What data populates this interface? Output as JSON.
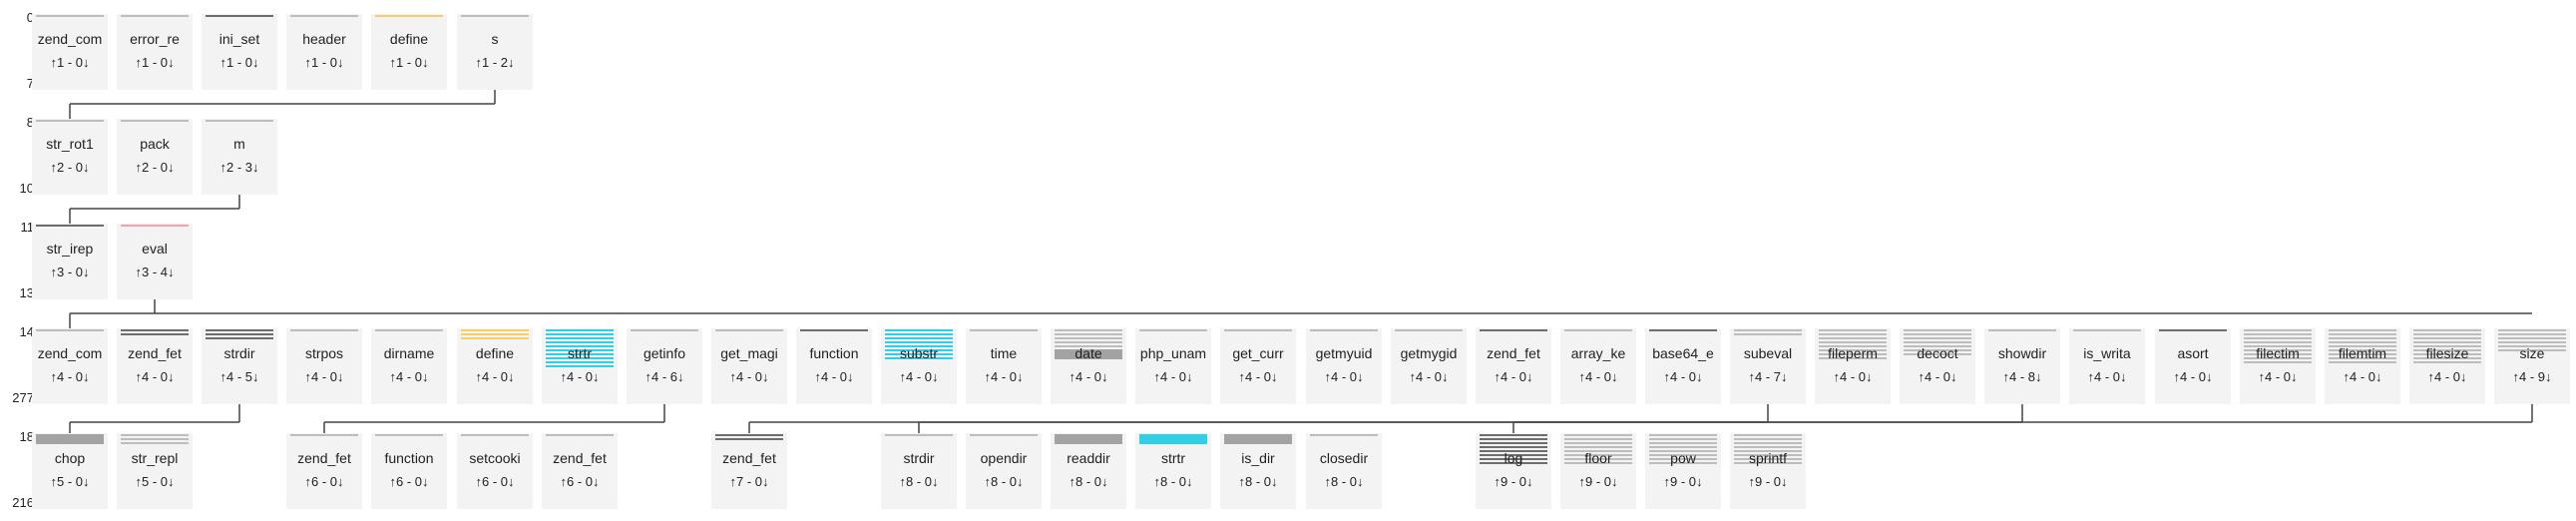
{
  "colors": {
    "gray": "#bdbdbd",
    "dark": "#6e6e6e",
    "gold": "#f3cf6b",
    "cyan": "#2fd0e6",
    "pink": "#f2a1ad",
    "solid_dark": "#a3a3a3",
    "node_bg": "#f3f3f3",
    "connector": "#444444"
  },
  "rows": [
    {
      "labels": {
        "start": "0",
        "end": "7"
      },
      "nodes": [
        {
          "name": "zend_com",
          "counts": "↑1 - 0↓",
          "stripes": [
            [
              "gray",
              1
            ]
          ]
        },
        {
          "name": "error_re",
          "counts": "↑1 - 0↓",
          "stripes": [
            [
              "gray",
              1
            ]
          ]
        },
        {
          "name": "ini_set",
          "counts": "↑1 - 0↓",
          "stripes": [
            [
              "dark",
              1
            ]
          ]
        },
        {
          "name": "header",
          "counts": "↑1 - 0↓",
          "stripes": [
            [
              "gray",
              1
            ]
          ]
        },
        {
          "name": "define",
          "counts": "↑1 - 0↓",
          "stripes": [
            [
              "gold",
              1
            ]
          ]
        },
        {
          "name": "s",
          "counts": "↑1 - 2↓",
          "stripes": [
            [
              "gray",
              1
            ]
          ]
        }
      ]
    },
    {
      "labels": {
        "start": "8",
        "end": "10"
      },
      "nodes": [
        {
          "name": "str_rot1",
          "counts": "↑2 - 0↓",
          "stripes": [
            [
              "gray",
              1
            ]
          ]
        },
        {
          "name": "pack",
          "counts": "↑2 - 0↓",
          "stripes": [
            [
              "gray",
              1
            ]
          ]
        },
        {
          "name": "m",
          "counts": "↑2 - 3↓",
          "stripes": [
            [
              "gray",
              1
            ]
          ]
        }
      ]
    },
    {
      "labels": {
        "start": "11",
        "end": "13"
      },
      "nodes": [
        {
          "name": "str_irep",
          "counts": "↑3 - 0↓",
          "stripes": [
            [
              "dark",
              1
            ]
          ]
        },
        {
          "name": "eval",
          "counts": "↑3 - 4↓",
          "stripes": [
            [
              "pink",
              1
            ]
          ]
        }
      ]
    },
    {
      "labels": {
        "start": "14",
        "end": "277"
      },
      "nodes": [
        {
          "name": "zend_com",
          "counts": "↑4 - 0↓",
          "stripes": [
            [
              "gray",
              1
            ]
          ]
        },
        {
          "name": "zend_fet",
          "counts": "↑4 - 0↓",
          "stripes": [
            [
              "dark",
              2
            ]
          ]
        },
        {
          "name": "strdir",
          "counts": "↑4 - 5↓",
          "stripes": [
            [
              "dark",
              3
            ]
          ]
        },
        {
          "name": "strpos",
          "counts": "↑4 - 0↓",
          "stripes": [
            [
              "gray",
              1
            ]
          ]
        },
        {
          "name": "dirname",
          "counts": "↑4 - 0↓",
          "stripes": [
            [
              "gray",
              1
            ]
          ]
        },
        {
          "name": "define",
          "counts": "↑4 - 0↓",
          "stripes": [
            [
              "gold",
              3
            ]
          ]
        },
        {
          "name": "strtr",
          "counts": "↑4 - 0↓",
          "stripes": [
            [
              "cyan",
              10
            ]
          ]
        },
        {
          "name": "getinfo",
          "counts": "↑4 - 6↓",
          "stripes": [
            [
              "gray",
              1
            ]
          ]
        },
        {
          "name": "get_magi",
          "counts": "↑4 - 0↓",
          "stripes": [
            [
              "gray",
              1
            ]
          ]
        },
        {
          "name": "function",
          "counts": "↑4 - 0↓",
          "stripes": [
            [
              "dark",
              1
            ]
          ]
        },
        {
          "name": "substr",
          "counts": "↑4 - 0↓",
          "stripes": [
            [
              "cyan",
              8
            ]
          ]
        },
        {
          "name": "time",
          "counts": "↑4 - 0↓",
          "stripes": [
            [
              "gray",
              1
            ]
          ]
        },
        {
          "name": "date",
          "counts": "↑4 - 0↓",
          "stripes": [
            [
              "gray",
              5
            ],
            [
              "solid_dark",
              1
            ]
          ]
        },
        {
          "name": "php_unam",
          "counts": "↑4 - 0↓",
          "stripes": [
            [
              "gray",
              1
            ]
          ]
        },
        {
          "name": "get_curr",
          "counts": "↑4 - 0↓",
          "stripes": [
            [
              "gray",
              1
            ]
          ]
        },
        {
          "name": "getmyuid",
          "counts": "↑4 - 0↓",
          "stripes": [
            [
              "gray",
              1
            ]
          ]
        },
        {
          "name": "getmygid",
          "counts": "↑4 - 0↓",
          "stripes": [
            [
              "gray",
              1
            ]
          ]
        },
        {
          "name": "zend_fet",
          "counts": "↑4 - 0↓",
          "stripes": [
            [
              "dark",
              1
            ]
          ]
        },
        {
          "name": "array_ke",
          "counts": "↑4 - 0↓",
          "stripes": [
            [
              "gray",
              1
            ]
          ]
        },
        {
          "name": "base64_e",
          "counts": "↑4 - 0↓",
          "stripes": [
            [
              "dark",
              1
            ]
          ]
        },
        {
          "name": "subeval",
          "counts": "↑4 - 7↓",
          "stripes": [
            [
              "gray",
              2
            ]
          ]
        },
        {
          "name": "fileperm",
          "counts": "↑4 - 0↓",
          "stripes": [
            [
              "gray",
              8
            ]
          ]
        },
        {
          "name": "decoct",
          "counts": "↑4 - 0↓",
          "stripes": [
            [
              "gray",
              7
            ]
          ]
        },
        {
          "name": "showdir",
          "counts": "↑4 - 8↓",
          "stripes": [
            [
              "gray",
              1
            ]
          ]
        },
        {
          "name": "is_writa",
          "counts": "↑4 - 0↓",
          "stripes": [
            [
              "gray",
              1
            ]
          ]
        },
        {
          "name": "asort",
          "counts": "↑4 - 0↓",
          "stripes": [
            [
              "dark",
              1
            ]
          ]
        },
        {
          "name": "filectim",
          "counts": "↑4 - 0↓",
          "stripes": [
            [
              "gray",
              9
            ]
          ]
        },
        {
          "name": "filemtim",
          "counts": "↑4 - 0↓",
          "stripes": [
            [
              "gray",
              9
            ]
          ]
        },
        {
          "name": "filesize",
          "counts": "↑4 - 0↓",
          "stripes": [
            [
              "gray",
              9
            ]
          ]
        },
        {
          "name": "size",
          "counts": "↑4 - 9↓",
          "stripes": [
            [
              "gray",
              6
            ]
          ]
        }
      ]
    },
    {
      "labels": {
        "start": "18",
        "end": "216"
      },
      "nodes": [
        {
          "name": "chop",
          "counts": "↑5 - 0↓",
          "stripes": [
            [
              "solid_dark",
              1
            ]
          ]
        },
        {
          "name": "str_repl",
          "counts": "↑5 - 0↓",
          "stripes": [
            [
              "gray",
              3
            ]
          ]
        },
        {
          "name": "zend_fet",
          "counts": "↑6 - 0↓",
          "stripes": [
            [
              "gray",
              1
            ]
          ]
        },
        {
          "name": "function",
          "counts": "↑6 - 0↓",
          "stripes": [
            [
              "gray",
              1
            ]
          ]
        },
        {
          "name": "setcooki",
          "counts": "↑6 - 0↓",
          "stripes": [
            [
              "gray",
              1
            ]
          ]
        },
        {
          "name": "zend_fet",
          "counts": "↑6 - 0↓",
          "stripes": [
            [
              "gray",
              1
            ]
          ]
        },
        {
          "name": "zend_fet",
          "counts": "↑7 - 0↓",
          "stripes": [
            [
              "dark",
              2
            ]
          ]
        },
        {
          "name": "strdir",
          "counts": "↑8 - 0↓",
          "stripes": [
            [
              "gray",
              1
            ]
          ]
        },
        {
          "name": "opendir",
          "counts": "↑8 - 0↓",
          "stripes": [
            [
              "gray",
              1
            ]
          ]
        },
        {
          "name": "readdir",
          "counts": "↑8 - 0↓",
          "stripes": [
            [
              "solid_dark",
              1
            ]
          ]
        },
        {
          "name": "strtr",
          "counts": "↑8 - 0↓",
          "stripes": [
            [
              "cyan",
              1
            ]
          ]
        },
        {
          "name": "is_dir",
          "counts": "↑8 - 0↓",
          "stripes": [
            [
              "solid_dark",
              1
            ]
          ]
        },
        {
          "name": "closedir",
          "counts": "↑8 - 0↓",
          "stripes": [
            [
              "gray",
              1
            ]
          ]
        },
        {
          "name": "log",
          "counts": "↑9 - 0↓",
          "stripes": [
            [
              "dark",
              8
            ]
          ]
        },
        {
          "name": "floor",
          "counts": "↑9 - 0↓",
          "stripes": [
            [
              "gray",
              8
            ]
          ]
        },
        {
          "name": "pow",
          "counts": "↑9 - 0↓",
          "stripes": [
            [
              "gray",
              8
            ]
          ]
        },
        {
          "name": "sprintf",
          "counts": "↑9 - 0↓",
          "stripes": [
            [
              "gray",
              8
            ]
          ]
        }
      ]
    }
  ]
}
